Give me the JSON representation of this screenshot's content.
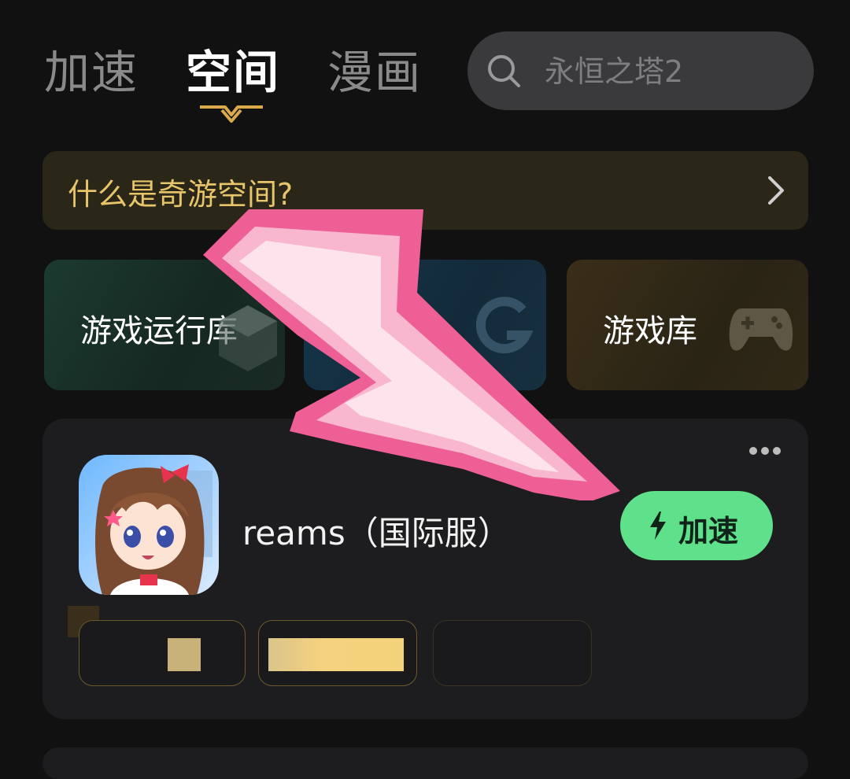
{
  "tabs": [
    {
      "label": "加速",
      "active": false
    },
    {
      "label": "空间",
      "active": true
    },
    {
      "label": "漫画",
      "active": false
    }
  ],
  "search": {
    "placeholder": "永恒之塔2"
  },
  "banner": {
    "text": "什么是奇游空间?"
  },
  "categories": [
    {
      "label": "游戏运行库",
      "icon": "cube-icon"
    },
    {
      "label": "",
      "icon": "g-logo-icon"
    },
    {
      "label": "游戏库",
      "icon": "gamepad-icon"
    }
  ],
  "game": {
    "title": "reams（国际服）",
    "action_label": "加速"
  },
  "colors": {
    "background": "#111112",
    "accent_green": "#5fe08a",
    "banner_text": "#e8c46a",
    "cursor_pink": "#ee5f95"
  }
}
